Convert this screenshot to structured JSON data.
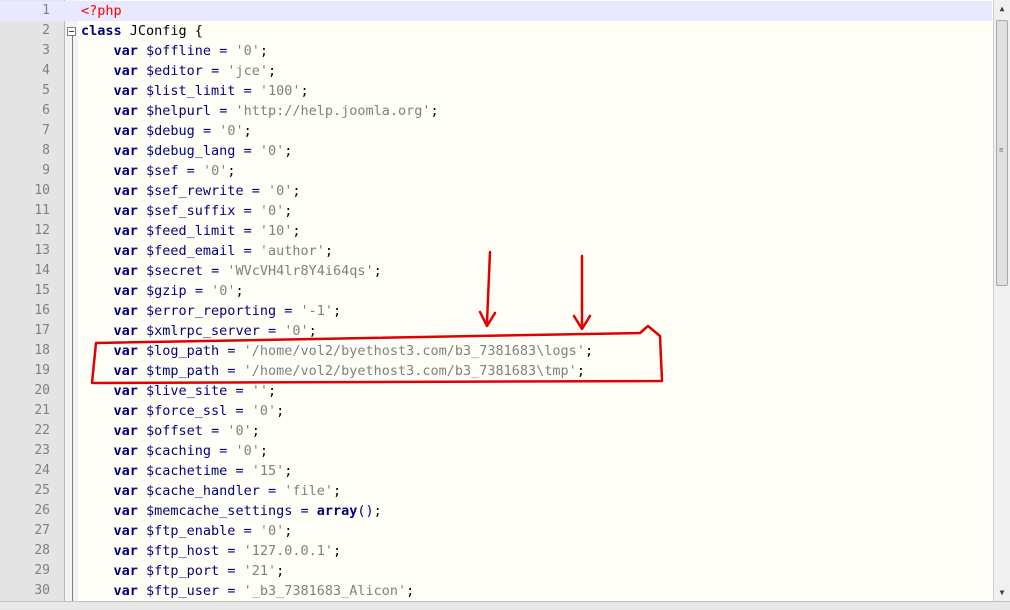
{
  "editor": {
    "lines": [
      {
        "n": "1",
        "segments": [
          {
            "cls": "php-tag",
            "t": "<?php"
          }
        ]
      },
      {
        "n": "2",
        "segments": [
          {
            "cls": "kw",
            "t": "class"
          },
          {
            "cls": "punct",
            "t": " JConfig {"
          }
        ]
      },
      {
        "n": "3",
        "segments": [
          {
            "cls": "punct",
            "t": "    "
          },
          {
            "cls": "kw",
            "t": "var"
          },
          {
            "cls": "var",
            "t": " $offline"
          },
          {
            "cls": "op",
            "t": " = "
          },
          {
            "cls": "str",
            "t": "'0'"
          },
          {
            "cls": "punct",
            "t": ";"
          }
        ]
      },
      {
        "n": "4",
        "segments": [
          {
            "cls": "punct",
            "t": "    "
          },
          {
            "cls": "kw",
            "t": "var"
          },
          {
            "cls": "var",
            "t": " $editor"
          },
          {
            "cls": "op",
            "t": " = "
          },
          {
            "cls": "str",
            "t": "'jce'"
          },
          {
            "cls": "punct",
            "t": ";"
          }
        ]
      },
      {
        "n": "5",
        "segments": [
          {
            "cls": "punct",
            "t": "    "
          },
          {
            "cls": "kw",
            "t": "var"
          },
          {
            "cls": "var",
            "t": " $list_limit"
          },
          {
            "cls": "op",
            "t": " = "
          },
          {
            "cls": "str",
            "t": "'100'"
          },
          {
            "cls": "punct",
            "t": ";"
          }
        ]
      },
      {
        "n": "6",
        "segments": [
          {
            "cls": "punct",
            "t": "    "
          },
          {
            "cls": "kw",
            "t": "var"
          },
          {
            "cls": "var",
            "t": " $helpurl"
          },
          {
            "cls": "op",
            "t": " = "
          },
          {
            "cls": "str",
            "t": "'http://help.joomla.org'"
          },
          {
            "cls": "punct",
            "t": ";"
          }
        ]
      },
      {
        "n": "7",
        "segments": [
          {
            "cls": "punct",
            "t": "    "
          },
          {
            "cls": "kw",
            "t": "var"
          },
          {
            "cls": "var",
            "t": " $debug"
          },
          {
            "cls": "op",
            "t": " = "
          },
          {
            "cls": "str",
            "t": "'0'"
          },
          {
            "cls": "punct",
            "t": ";"
          }
        ]
      },
      {
        "n": "8",
        "segments": [
          {
            "cls": "punct",
            "t": "    "
          },
          {
            "cls": "kw",
            "t": "var"
          },
          {
            "cls": "var",
            "t": " $debug_lang"
          },
          {
            "cls": "op",
            "t": " = "
          },
          {
            "cls": "str",
            "t": "'0'"
          },
          {
            "cls": "punct",
            "t": ";"
          }
        ]
      },
      {
        "n": "9",
        "segments": [
          {
            "cls": "punct",
            "t": "    "
          },
          {
            "cls": "kw",
            "t": "var"
          },
          {
            "cls": "var",
            "t": " $sef"
          },
          {
            "cls": "op",
            "t": " = "
          },
          {
            "cls": "str",
            "t": "'0'"
          },
          {
            "cls": "punct",
            "t": ";"
          }
        ]
      },
      {
        "n": "10",
        "segments": [
          {
            "cls": "punct",
            "t": "    "
          },
          {
            "cls": "kw",
            "t": "var"
          },
          {
            "cls": "var",
            "t": " $sef_rewrite"
          },
          {
            "cls": "op",
            "t": " = "
          },
          {
            "cls": "str",
            "t": "'0'"
          },
          {
            "cls": "punct",
            "t": ";"
          }
        ]
      },
      {
        "n": "11",
        "segments": [
          {
            "cls": "punct",
            "t": "    "
          },
          {
            "cls": "kw",
            "t": "var"
          },
          {
            "cls": "var",
            "t": " $sef_suffix"
          },
          {
            "cls": "op",
            "t": " = "
          },
          {
            "cls": "str",
            "t": "'0'"
          },
          {
            "cls": "punct",
            "t": ";"
          }
        ]
      },
      {
        "n": "12",
        "segments": [
          {
            "cls": "punct",
            "t": "    "
          },
          {
            "cls": "kw",
            "t": "var"
          },
          {
            "cls": "var",
            "t": " $feed_limit"
          },
          {
            "cls": "op",
            "t": " = "
          },
          {
            "cls": "str",
            "t": "'10'"
          },
          {
            "cls": "punct",
            "t": ";"
          }
        ]
      },
      {
        "n": "13",
        "segments": [
          {
            "cls": "punct",
            "t": "    "
          },
          {
            "cls": "kw",
            "t": "var"
          },
          {
            "cls": "var",
            "t": " $feed_email"
          },
          {
            "cls": "op",
            "t": " = "
          },
          {
            "cls": "str",
            "t": "'author'"
          },
          {
            "cls": "punct",
            "t": ";"
          }
        ]
      },
      {
        "n": "14",
        "segments": [
          {
            "cls": "punct",
            "t": "    "
          },
          {
            "cls": "kw",
            "t": "var"
          },
          {
            "cls": "var",
            "t": " $secret"
          },
          {
            "cls": "op",
            "t": " = "
          },
          {
            "cls": "str",
            "t": "'WVcVH4lr8Y4i64qs'"
          },
          {
            "cls": "punct",
            "t": ";"
          }
        ]
      },
      {
        "n": "15",
        "segments": [
          {
            "cls": "punct",
            "t": "    "
          },
          {
            "cls": "kw",
            "t": "var"
          },
          {
            "cls": "var",
            "t": " $gzip"
          },
          {
            "cls": "op",
            "t": " = "
          },
          {
            "cls": "str",
            "t": "'0'"
          },
          {
            "cls": "punct",
            "t": ";"
          }
        ]
      },
      {
        "n": "16",
        "segments": [
          {
            "cls": "punct",
            "t": "    "
          },
          {
            "cls": "kw",
            "t": "var"
          },
          {
            "cls": "var",
            "t": " $error_reporting"
          },
          {
            "cls": "op",
            "t": " = "
          },
          {
            "cls": "str",
            "t": "'-1'"
          },
          {
            "cls": "punct",
            "t": ";"
          }
        ]
      },
      {
        "n": "17",
        "segments": [
          {
            "cls": "punct",
            "t": "    "
          },
          {
            "cls": "kw",
            "t": "var"
          },
          {
            "cls": "var",
            "t": " $xmlrpc_server"
          },
          {
            "cls": "op",
            "t": " = "
          },
          {
            "cls": "str",
            "t": "'0'"
          },
          {
            "cls": "punct",
            "t": ";"
          }
        ]
      },
      {
        "n": "18",
        "segments": [
          {
            "cls": "punct",
            "t": "    "
          },
          {
            "cls": "kw",
            "t": "var"
          },
          {
            "cls": "var",
            "t": " $log_path"
          },
          {
            "cls": "op",
            "t": " = "
          },
          {
            "cls": "str",
            "t": "'/home/vol2/byethost3.com/b3_7381683\\logs'"
          },
          {
            "cls": "punct",
            "t": ";"
          }
        ]
      },
      {
        "n": "19",
        "segments": [
          {
            "cls": "punct",
            "t": "    "
          },
          {
            "cls": "kw",
            "t": "var"
          },
          {
            "cls": "var",
            "t": " $tmp_path"
          },
          {
            "cls": "op",
            "t": " = "
          },
          {
            "cls": "str",
            "t": "'/home/vol2/byethost3.com/b3_7381683\\tmp'"
          },
          {
            "cls": "punct",
            "t": ";"
          }
        ]
      },
      {
        "n": "20",
        "segments": [
          {
            "cls": "punct",
            "t": "    "
          },
          {
            "cls": "kw",
            "t": "var"
          },
          {
            "cls": "var",
            "t": " $live_site"
          },
          {
            "cls": "op",
            "t": " = "
          },
          {
            "cls": "str",
            "t": "''"
          },
          {
            "cls": "punct",
            "t": ";"
          }
        ]
      },
      {
        "n": "21",
        "segments": [
          {
            "cls": "punct",
            "t": "    "
          },
          {
            "cls": "kw",
            "t": "var"
          },
          {
            "cls": "var",
            "t": " $force_ssl"
          },
          {
            "cls": "op",
            "t": " = "
          },
          {
            "cls": "str",
            "t": "'0'"
          },
          {
            "cls": "punct",
            "t": ";"
          }
        ]
      },
      {
        "n": "22",
        "segments": [
          {
            "cls": "punct",
            "t": "    "
          },
          {
            "cls": "kw",
            "t": "var"
          },
          {
            "cls": "var",
            "t": " $offset"
          },
          {
            "cls": "op",
            "t": " = "
          },
          {
            "cls": "str",
            "t": "'0'"
          },
          {
            "cls": "punct",
            "t": ";"
          }
        ]
      },
      {
        "n": "23",
        "segments": [
          {
            "cls": "punct",
            "t": "    "
          },
          {
            "cls": "kw",
            "t": "var"
          },
          {
            "cls": "var",
            "t": " $caching"
          },
          {
            "cls": "op",
            "t": " = "
          },
          {
            "cls": "str",
            "t": "'0'"
          },
          {
            "cls": "punct",
            "t": ";"
          }
        ]
      },
      {
        "n": "24",
        "segments": [
          {
            "cls": "punct",
            "t": "    "
          },
          {
            "cls": "kw",
            "t": "var"
          },
          {
            "cls": "var",
            "t": " $cachetime"
          },
          {
            "cls": "op",
            "t": " = "
          },
          {
            "cls": "str",
            "t": "'15'"
          },
          {
            "cls": "punct",
            "t": ";"
          }
        ]
      },
      {
        "n": "25",
        "segments": [
          {
            "cls": "punct",
            "t": "    "
          },
          {
            "cls": "kw",
            "t": "var"
          },
          {
            "cls": "var",
            "t": " $cache_handler"
          },
          {
            "cls": "op",
            "t": " = "
          },
          {
            "cls": "str",
            "t": "'file'"
          },
          {
            "cls": "punct",
            "t": ";"
          }
        ]
      },
      {
        "n": "26",
        "segments": [
          {
            "cls": "punct",
            "t": "    "
          },
          {
            "cls": "kw",
            "t": "var"
          },
          {
            "cls": "var",
            "t": " $memcache_settings"
          },
          {
            "cls": "op",
            "t": " = "
          },
          {
            "cls": "kw",
            "t": "array"
          },
          {
            "cls": "op",
            "t": "()"
          },
          {
            "cls": "punct",
            "t": ";"
          }
        ]
      },
      {
        "n": "27",
        "segments": [
          {
            "cls": "punct",
            "t": "    "
          },
          {
            "cls": "kw",
            "t": "var"
          },
          {
            "cls": "var",
            "t": " $ftp_enable"
          },
          {
            "cls": "op",
            "t": " = "
          },
          {
            "cls": "str",
            "t": "'0'"
          },
          {
            "cls": "punct",
            "t": ";"
          }
        ]
      },
      {
        "n": "28",
        "segments": [
          {
            "cls": "punct",
            "t": "    "
          },
          {
            "cls": "kw",
            "t": "var"
          },
          {
            "cls": "var",
            "t": " $ftp_host"
          },
          {
            "cls": "op",
            "t": " = "
          },
          {
            "cls": "str",
            "t": "'127.0.0.1'"
          },
          {
            "cls": "punct",
            "t": ";"
          }
        ]
      },
      {
        "n": "29",
        "segments": [
          {
            "cls": "punct",
            "t": "    "
          },
          {
            "cls": "kw",
            "t": "var"
          },
          {
            "cls": "var",
            "t": " $ftp_port"
          },
          {
            "cls": "op",
            "t": " = "
          },
          {
            "cls": "str",
            "t": "'21'"
          },
          {
            "cls": "punct",
            "t": ";"
          }
        ]
      },
      {
        "n": "30",
        "segments": [
          {
            "cls": "punct",
            "t": "    "
          },
          {
            "cls": "kw",
            "t": "var"
          },
          {
            "cls": "var",
            "t": " $ftp_user"
          },
          {
            "cls": "op",
            "t": " = "
          },
          {
            "cls": "str",
            "t": "'_b3_7381683_Alicon'"
          },
          {
            "cls": "punct",
            "t": ";"
          }
        ]
      }
    ],
    "current_line": "1",
    "colors": {
      "keyword": "#000080",
      "string": "#808080",
      "php_tag": "#ff0000",
      "annotation": "#e00000"
    }
  },
  "scrollbar": {
    "up_arrow_icon": "triangle-up-icon",
    "down_arrow_icon": "triangle-down-icon",
    "up_glyph": "▲",
    "down_glyph": "▼"
  }
}
